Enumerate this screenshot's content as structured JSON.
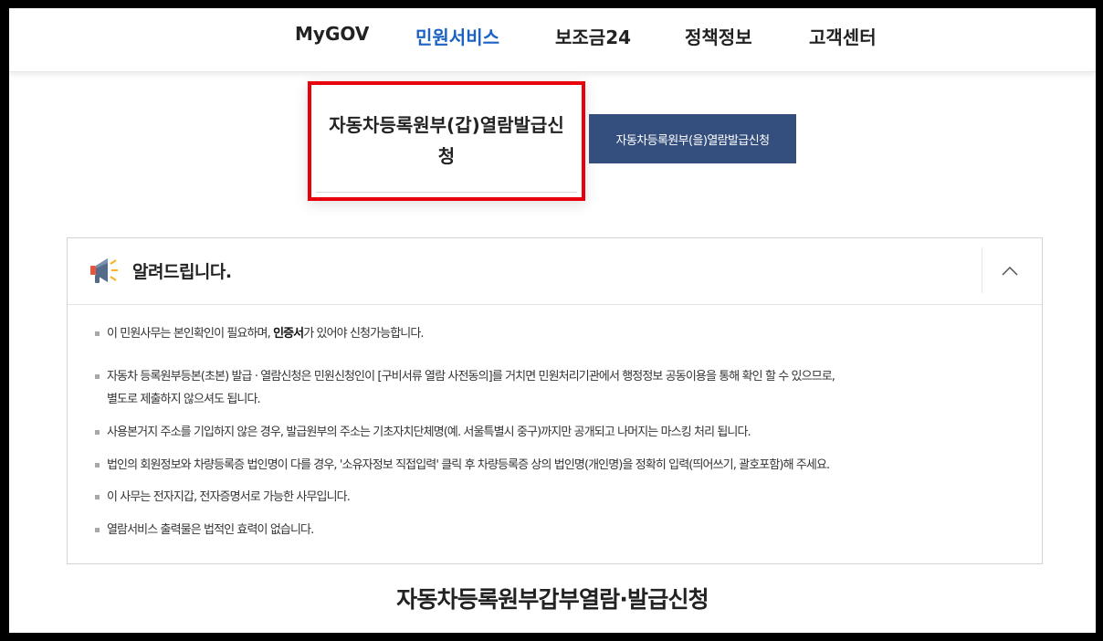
{
  "nav": {
    "items": [
      {
        "label": "MyGOV"
      },
      {
        "label": "민원서비스"
      },
      {
        "label": "보조금24"
      },
      {
        "label": "정책정보"
      },
      {
        "label": "고객센터"
      }
    ],
    "active_color": "#1c61c4"
  },
  "tabs": {
    "active": {
      "label": "자동차등록원부(갑)열람발급신청"
    },
    "other": {
      "label": "자동차등록원부(을)열람발급신청"
    },
    "highlight_color": "#e8000d",
    "other_bg": "#344f7e"
  },
  "notice": {
    "title": "알려드립니다.",
    "icon": "megaphone-icon",
    "toggle_icon": "chevron-up-icon",
    "items": [
      {
        "pre": "이 민원사무는 본인확인이 필요하며, ",
        "bold": "인증서",
        "post": "가 있어야 신청가능합니다."
      },
      {
        "line1": "자동차 등록원부등본(초본) 발급 · 열람신청은 민원신청인이 [구비서류 열람 사전동의]를 거치면 민원처리기관에서 행정정보 공동이용을 통해 확인 할 수 있으므로,",
        "line2": "별도로 제출하지 않으셔도 됩니다."
      },
      {
        "text": "사용본거지 주소를 기입하지 않은 경우, 발급원부의 주소는 기초자치단체명(예. 서울특별시 중구)까지만 공개되고 나머지는 마스킹 처리 됩니다."
      },
      {
        "text": "법인의 회원정보와 차량등록증 법인명이 다를 경우, '소유자정보 직접입력' 클릭 후 차량등록증 상의 법인명(개인명)을 정확히 입력(띄어쓰기, 괄호포함)해 주세요."
      },
      {
        "text": "이 사무는 전자지갑, 전자증명서로 가능한 사무입니다."
      },
      {
        "text": "열람서비스 출력물은 법적인 효력이 없습니다."
      }
    ]
  },
  "section": {
    "title": "자동차등록원부갑부열람·발급신청"
  }
}
